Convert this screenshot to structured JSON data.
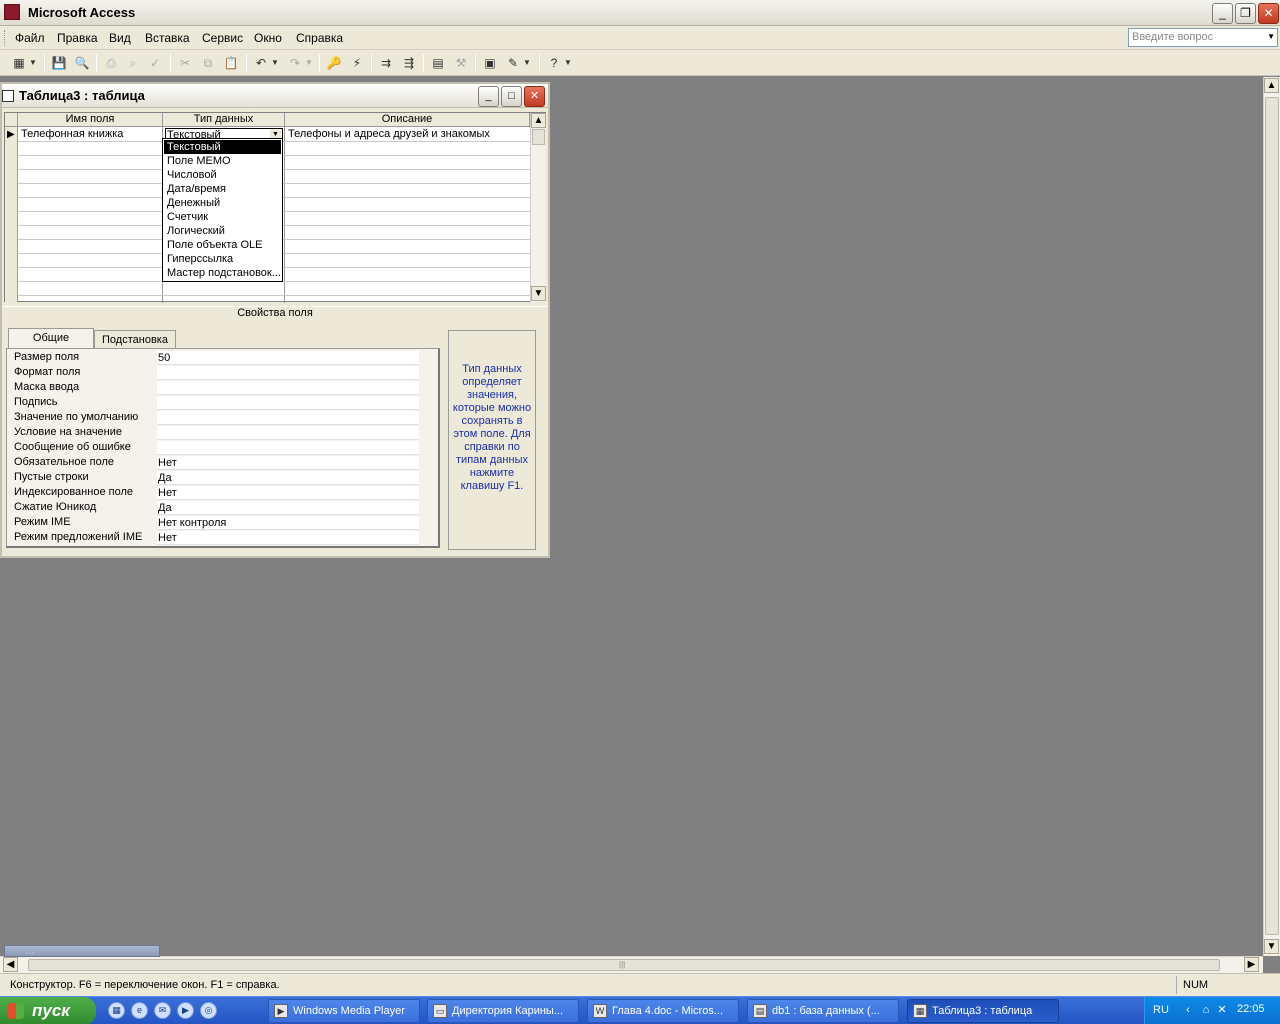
{
  "app": {
    "title": "Microsoft Access"
  },
  "menu": {
    "items": [
      "Файл",
      "Правка",
      "Вид",
      "Вставка",
      "Сервис",
      "Окно",
      "Справка"
    ]
  },
  "ask": {
    "placeholder": "Введите вопрос"
  },
  "child": {
    "title": "Таблица3 : таблица"
  },
  "grid": {
    "headers": [
      "Имя поля",
      "Тип данных",
      "Описание"
    ],
    "row1": {
      "name": "Телефонная книжка",
      "type": "Текстовый",
      "description": "Телефоны и адреса друзей и знакомых"
    }
  },
  "dropdown": {
    "options": [
      "Текстовый",
      "Поле MEMO",
      "Числовой",
      "Дата/время",
      "Денежный",
      "Счетчик",
      "Логический",
      "Поле объекта OLE",
      "Гиперссылка",
      "Мастер подстановок..."
    ],
    "selected": "Текстовый"
  },
  "props": {
    "title": "Свойства поля",
    "tabs": [
      "Общие",
      "Подстановка"
    ],
    "rows": [
      {
        "label": "Размер поля",
        "value": "50"
      },
      {
        "label": "Формат поля",
        "value": ""
      },
      {
        "label": "Маска ввода",
        "value": ""
      },
      {
        "label": "Подпись",
        "value": ""
      },
      {
        "label": "Значение по умолчанию",
        "value": ""
      },
      {
        "label": "Условие на значение",
        "value": ""
      },
      {
        "label": "Сообщение об ошибке",
        "value": ""
      },
      {
        "label": "Обязательное поле",
        "value": "Нет"
      },
      {
        "label": "Пустые строки",
        "value": "Да"
      },
      {
        "label": "Индексированное поле",
        "value": "Нет"
      },
      {
        "label": "Сжатие Юникод",
        "value": "Да"
      },
      {
        "label": "Режим IME",
        "value": "Нет контроля"
      },
      {
        "label": "Режим предложений IME",
        "value": "Нет"
      }
    ],
    "help": "Тип данных определяет значения, которые можно сохранять в этом поле. Для справки по типам данных нажмите клавишу F1."
  },
  "status": {
    "message": "Конструктор.  F6 = переключение окон.  F1 = справка.",
    "num": "NUM"
  },
  "taskbar": {
    "start": "пуск",
    "tasks": [
      "Windows Media Player",
      "Директория Карины...",
      "Глава 4.doc - Micros...",
      "db1 : база данных (...",
      "Таблица3 : таблица"
    ],
    "lang": "RU",
    "clock": "22:05"
  },
  "colors": {
    "workspace": "#808080",
    "help_text": "#1b2ea8",
    "taskbar": "#245edb",
    "start": "#3c9b37"
  }
}
